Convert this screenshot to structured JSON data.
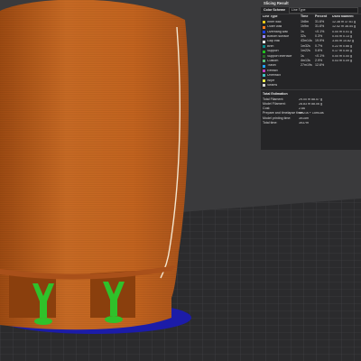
{
  "panel": {
    "title": "Slicing Result",
    "color_scheme_label": "Color Scheme",
    "color_scheme_value": "Line Type",
    "columns": [
      "Line Type",
      "Time",
      "Percent",
      "Used filament"
    ],
    "rows": [
      {
        "label": "Inner wall",
        "color": "#e8c818",
        "time": "1h8m",
        "percent": "31.6%",
        "used": "12.38 m  37.61 g"
      },
      {
        "label": "Outer wall",
        "color": "#ff7a1a",
        "time": "1h9m",
        "percent": "31.6%",
        "used": "12.42 m  38.54 g"
      },
      {
        "label": "Overhang wall",
        "color": "#1a3cff",
        "time": "1s",
        "percent": "<0.1%",
        "used": "0.00 m  0.01 g"
      },
      {
        "label": "Bottom surface",
        "color": "#9c8cff",
        "time": "32s",
        "percent": "0.3%",
        "used": "0.04 m  0.13 g"
      },
      {
        "label": "Gap infill",
        "color": "#ffffff",
        "time": "43m14s",
        "percent": "19.9%",
        "used": "3.54 m  10.82 g"
      },
      {
        "label": "Brim",
        "color": "#0a8c8c",
        "time": "1m32s",
        "percent": "0.7%",
        "used": "0.22 m  0.66 g"
      },
      {
        "label": "Support",
        "color": "#1fbf1f",
        "time": "1m22s",
        "percent": "0.6%",
        "used": "0.17 m  0.50 g"
      },
      {
        "label": "Support interface",
        "color": "#2a6a2a",
        "time": "1s",
        "percent": "<0.1%",
        "used": "0.00 m  0.00 g"
      },
      {
        "label": "Custom",
        "color": "#5ac07a",
        "time": "4m13s",
        "percent": "2.9%",
        "used": "0.03 m  0.09 g"
      },
      {
        "label": "Travel",
        "color": "#20a0ff",
        "time": "27m19s",
        "percent": "12.6%",
        "used": ""
      },
      {
        "label": "Retract",
        "color": "#c040c0",
        "time": "",
        "percent": "",
        "used": ""
      },
      {
        "label": "Unretract",
        "color": "#40c0c0",
        "time": "",
        "percent": "",
        "used": ""
      },
      {
        "label": "Wipe",
        "color": "#e8e84a",
        "time": "",
        "percent": "",
        "used": ""
      },
      {
        "label": "Seams",
        "color": "#d0d0d0",
        "time": "",
        "percent": "",
        "used": ""
      }
    ],
    "totals_title": "Total Estimation",
    "totals": [
      {
        "key": "Total Filament:",
        "value": "29.00 m    88.57 g"
      },
      {
        "key": "Model Filament:",
        "value": "28.83 m    88.06 g"
      },
      {
        "key": "Cost:",
        "value": "2.66"
      },
      {
        "key": "Prepare and timelapse time:",
        "value": "4m21s + 15m18s"
      },
      {
        "key": "Model printing time:",
        "value": "3h15m"
      },
      {
        "key": "Total time:",
        "value": "3h37m"
      }
    ]
  },
  "scene": {
    "background_color": "#3a3a3c",
    "bed_color": "#2b2b2d",
    "model_color": "#c2621e",
    "support_color": "#2fc12a",
    "brim_color": "#1c1ca8"
  }
}
